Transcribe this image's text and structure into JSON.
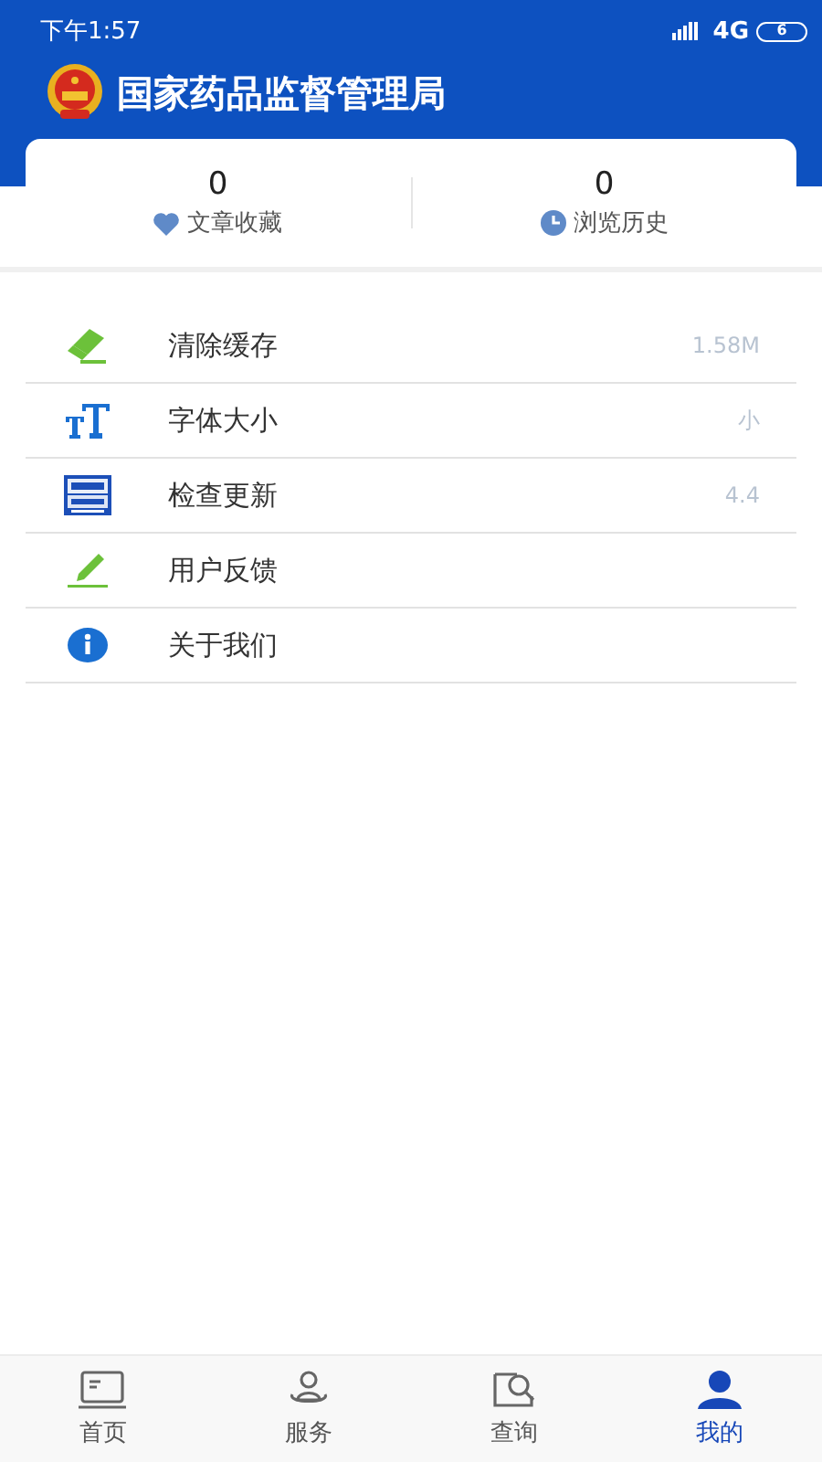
{
  "status_bar": {
    "time": "下午1:57",
    "network": "4G",
    "battery": "6"
  },
  "header": {
    "title": "国家药品监督管理局"
  },
  "stats": [
    {
      "kind": "favorites",
      "count": "0",
      "label": "文章收藏"
    },
    {
      "kind": "history",
      "count": "0",
      "label": "浏览历史"
    }
  ],
  "menu": [
    {
      "kind": "eraser",
      "label": "清除缓存",
      "value": "1.58M"
    },
    {
      "kind": "font",
      "label": "字体大小",
      "value": "小"
    },
    {
      "kind": "logo",
      "label": "检查更新",
      "value": "4.4"
    },
    {
      "kind": "pencil",
      "label": "用户反馈"
    },
    {
      "kind": "info",
      "label": "关于我们"
    }
  ],
  "tabs": [
    {
      "kind": "home",
      "label": "首页",
      "selected": false
    },
    {
      "kind": "service",
      "label": "服务",
      "selected": false
    },
    {
      "kind": "search",
      "label": "查询",
      "selected": false
    },
    {
      "kind": "me",
      "label": "我的",
      "selected": true
    }
  ]
}
